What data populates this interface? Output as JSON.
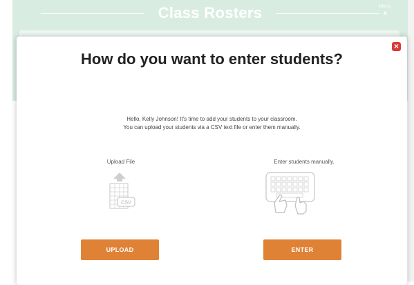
{
  "background": {
    "title": "Class Rosters",
    "menu_label": "Menu"
  },
  "modal": {
    "title": "How do you want to enter students?",
    "intro_line1": "Hello, Kelly Johnson! It's time to add your students to your classroom.",
    "intro_line2": "You can upload your students via a CSV text file or enter them manually.",
    "upload": {
      "label": "Upload File",
      "icon_text": "CSV",
      "button": "UPLOAD"
    },
    "manual": {
      "label": "Enter students manually.",
      "button": "ENTER"
    },
    "close_icon": "close-x-icon"
  },
  "colors": {
    "accent": "#e08236",
    "header_bg": "#d9ece2",
    "close": "#d83a35"
  }
}
